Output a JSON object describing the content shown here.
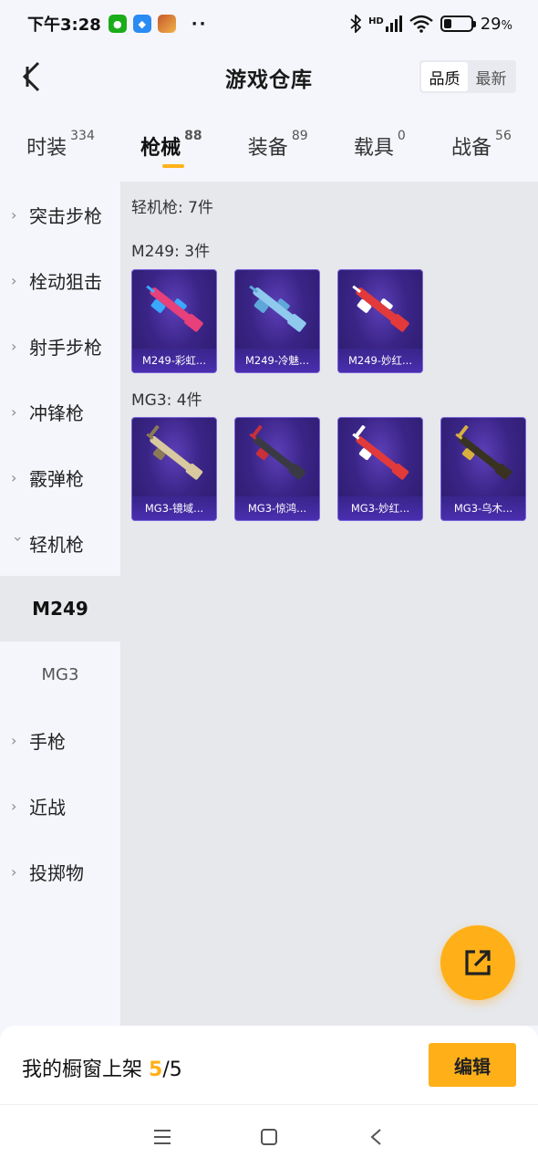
{
  "status_bar": {
    "time": "下午3:28",
    "hd": "HD",
    "battery_pct": "29",
    "battery_suffix": "%",
    "battery_level": 0.29,
    "dots": "··"
  },
  "header": {
    "title": "游戏仓库",
    "sort_options": [
      "品质",
      "最新"
    ],
    "sort_active": "品质"
  },
  "tabs": [
    {
      "label": "时装",
      "count": "334"
    },
    {
      "label": "枪械",
      "count": "88",
      "active": true
    },
    {
      "label": "装备",
      "count": "89"
    },
    {
      "label": "载具",
      "count": "0"
    },
    {
      "label": "战备",
      "count": "56"
    }
  ],
  "sidebar": {
    "items": [
      {
        "label": "突击步枪",
        "expanded": false
      },
      {
        "label": "栓动狙击",
        "expanded": false
      },
      {
        "label": "射手步枪",
        "expanded": false
      },
      {
        "label": "冲锋枪",
        "expanded": false
      },
      {
        "label": "霰弹枪",
        "expanded": false
      },
      {
        "label": "轻机枪",
        "expanded": true
      },
      {
        "label": "M249",
        "sub": true,
        "active": true
      },
      {
        "label": "MG3",
        "sub": true
      },
      {
        "label": "手枪",
        "expanded": false
      },
      {
        "label": "近战",
        "expanded": false
      },
      {
        "label": "投掷物",
        "expanded": false
      }
    ]
  },
  "content": {
    "category_summary": "轻机枪: 7件",
    "groups": [
      {
        "title": "M249: 3件",
        "items": [
          {
            "label": "M249-彩虹...",
            "color": "#e8407a",
            "accent": "#3aa8ff"
          },
          {
            "label": "M249-冷魅...",
            "color": "#8fc9ee",
            "accent": "#5da8d8"
          },
          {
            "label": "M249-妙红...",
            "color": "#e23a3a",
            "accent": "#ffffff"
          }
        ]
      },
      {
        "title": "MG3: 4件",
        "items": [
          {
            "label": "MG3-镜域...",
            "color": "#d8c9a0",
            "accent": "#8a7a55"
          },
          {
            "label": "MG3-惊鸿...",
            "color": "#3a3a44",
            "accent": "#c8303a"
          },
          {
            "label": "MG3-妙红...",
            "color": "#e23a3a",
            "accent": "#ffffff"
          },
          {
            "label": "MG3-乌木...",
            "color": "#3a3220",
            "accent": "#d8b040"
          }
        ]
      }
    ]
  },
  "bottom": {
    "showcase_label": "我的橱窗上架",
    "showcase_count": "5",
    "showcase_sep": "/",
    "showcase_total": "5",
    "edit_label": "编辑"
  },
  "colors": {
    "accent": "#ffb018",
    "card_bg": "#3a2587"
  }
}
